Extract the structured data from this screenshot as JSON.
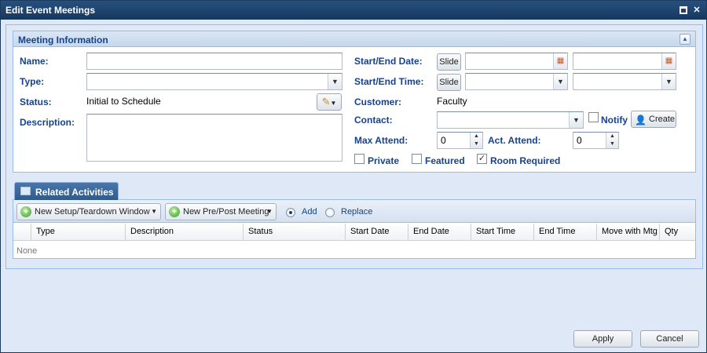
{
  "window": {
    "title": "Edit Event Meetings"
  },
  "meeting_info": {
    "panel_title": "Meeting Information",
    "name_label": "Name:",
    "name_value": "",
    "type_label": "Type:",
    "type_value": "",
    "status_label": "Status:",
    "status_value": "Initial to Schedule",
    "description_label": "Description:",
    "description_value": "",
    "start_end_date_label": "Start/End Date:",
    "start_end_time_label": "Start/End Time:",
    "slide_label": "Slide",
    "start_date_value": "",
    "end_date_value": "",
    "start_time_value": "",
    "end_time_value": "",
    "customer_label": "Customer:",
    "customer_value": "Faculty",
    "contact_label": "Contact:",
    "contact_value": "",
    "notify_label": "Notify",
    "notify_checked": false,
    "create_label": "Create",
    "max_attend_label": "Max Attend:",
    "max_attend_value": "0",
    "act_attend_label": "Act. Attend:",
    "act_attend_value": "0",
    "private_label": "Private",
    "private_checked": false,
    "featured_label": "Featured",
    "featured_checked": false,
    "room_required_label": "Room Required",
    "room_required_checked": true
  },
  "related_activities": {
    "tab_label": "Related Activities",
    "toolbar": {
      "setup_button": "New Setup/Teardown Window",
      "prepost_button": "New Pre/Post Meeting",
      "add_label": "Add",
      "replace_label": "Replace",
      "selected_mode": "Add"
    },
    "columns": [
      "Type",
      "Description",
      "Status",
      "Start Date",
      "End Date",
      "Start Time",
      "End Time",
      "Move with Mtg",
      "Qty"
    ],
    "empty_text": "None"
  },
  "footer": {
    "apply_label": "Apply",
    "cancel_label": "Cancel"
  },
  "colors": {
    "title_bar": "#1d4370",
    "label_text": "#15428b",
    "panel_border": "#99bbe8",
    "body_background": "#dfe8f6"
  },
  "icons": {
    "window_maximize": "maximize-icon",
    "window_close": "close-icon",
    "panel_collapse": "collapse-up-icon",
    "status_edit": "pencil-icon",
    "calendar": "calendar-icon",
    "create_contact": "add-user-icon",
    "tab": "activities-icon",
    "toolbar_add": "plus-circle-icon"
  }
}
